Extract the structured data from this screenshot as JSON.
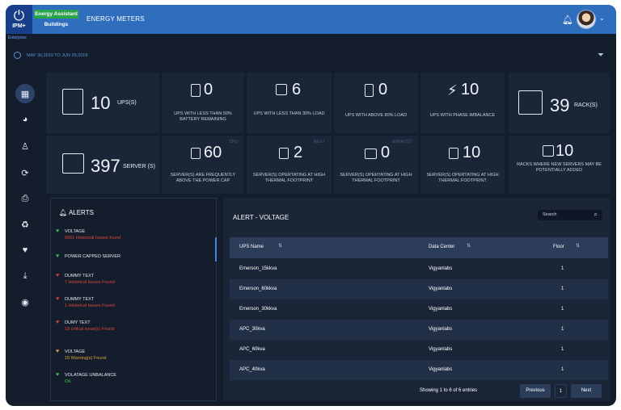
{
  "header": {
    "app_name": "IPM+",
    "app_sub": "Enterprise",
    "brand_top": "Energy Assistant",
    "brand_bottom": "Buildings",
    "page_title": "ENERGY METERS"
  },
  "date_range": "MAY 30,2019 TO JUN 29,2019",
  "sidebar": {
    "items": [
      {
        "icon": "dashboard-icon",
        "active": true
      },
      {
        "icon": "pie-chart-icon"
      },
      {
        "icon": "hierarchy-icon"
      },
      {
        "icon": "sync-icon"
      },
      {
        "icon": "inbox-icon"
      },
      {
        "icon": "recycle-icon"
      },
      {
        "icon": "heartbeat-icon"
      },
      {
        "icon": "download-icon"
      },
      {
        "icon": "user-icon"
      }
    ]
  },
  "tiles": {
    "ups": {
      "value": "10",
      "unit": "UPS(S)"
    },
    "ups_low_battery": {
      "value": "0",
      "caption": "UPS WITH LESS THAN 50% BATTERY REMAINING"
    },
    "ups_low_load": {
      "value": "6",
      "caption": "UPS WITH LESS THAN 30% LOAD"
    },
    "ups_high_load": {
      "value": "0",
      "caption": "UPS WITH ABOVE 80% LOAD"
    },
    "ups_phase": {
      "value": "10",
      "caption": "UPS WITH PHASE IMBALANCE"
    },
    "racks": {
      "value": "39",
      "unit": "RACK(S)"
    },
    "servers": {
      "value": "397",
      "unit": "SERVER (S)"
    },
    "servers_cpu": {
      "value": "60",
      "tag": "CPU",
      "caption": "SERVER(S) ARE FREQUENTLY ABOVE THE POWER CAP"
    },
    "servers_inlet": {
      "value": "2",
      "tag": "INLET",
      "caption": "SERVER(S) OPERTATING AT HIGH THERMAL FOOTPRINT"
    },
    "servers_exhaust": {
      "value": "0",
      "tag": "EXHAUST",
      "caption": "SERVER(S) OPERTATING AT HIGH THERMAL FOOTPRINT"
    },
    "servers_thermal": {
      "value": "10",
      "caption": "SERVER(S) OPERTATING AT HIGH THERMAL FOOTPRINT"
    },
    "racks_new": {
      "value": "10",
      "caption": "RACKS WHERE NEW SERVERS MAY BE POTENTIALLY ADDED"
    }
  },
  "alerts": {
    "title": "ALERTS",
    "items": [
      {
        "name": "VOLTAGE",
        "detail": "6051 Historical Issues found",
        "color": "#3fbf5a",
        "detail_color": "#e0453c"
      },
      {
        "name": "POWER CAPPED SERVER",
        "detail": "",
        "color": "#3fbf5a",
        "detail_color": "#e0453c"
      },
      {
        "name": "DUMMY TEXT",
        "detail": "7 Historical Issues Found",
        "color": "#e0453c",
        "detail_color": "#e0453c"
      },
      {
        "name": "DUMMY TEXT",
        "detail": "1 Historical Issues Found",
        "color": "#e0453c",
        "detail_color": "#e0453c"
      },
      {
        "name": "DUMY TEXT",
        "detail": "19 critical issue(s) Found",
        "color": "#e0453c",
        "detail_color": "#e0453c"
      },
      {
        "name": "VOLTAGE",
        "detail": "15 Warning(s) Found",
        "color": "#e0a13c",
        "detail_color": "#e0a13c"
      },
      {
        "name": "VOLATAGE UNBALANCE",
        "detail": "OK",
        "color": "#3fbf5a",
        "detail_color": "#3fbf5a"
      }
    ]
  },
  "voltage": {
    "title": "ALERT - VOLTAGE",
    "search_placeholder": "Search",
    "columns": [
      "UPS Name",
      "Data Center",
      "Floor"
    ],
    "rows": [
      [
        "Emerson_15kkva",
        "Vigyanlabs",
        "1"
      ],
      [
        "Emerson_60kkva",
        "Vigyanlabs",
        "1"
      ],
      [
        "Emerson_30kkva",
        "Vigyanlabs",
        "1"
      ],
      [
        "APC_30kva",
        "Vigyanlabs",
        "1"
      ],
      [
        "APC_60kva",
        "Vigyanlabs",
        "1"
      ],
      [
        "APC_40kva",
        "Vigyanlabs",
        "1"
      ]
    ],
    "footer": "Showing 1 to 6 of 6 entries",
    "pagination": {
      "prev": "Previous",
      "page": "1",
      "next": "Next"
    }
  }
}
